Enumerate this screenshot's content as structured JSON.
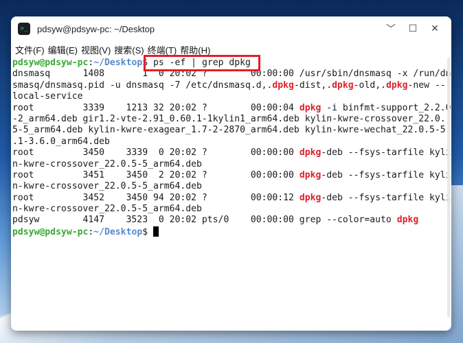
{
  "window": {
    "title": "pdsyw@pdsyw-pc: ~/Desktop",
    "icon": "terminal-icon",
    "controls": {
      "minimize": "﹀",
      "maximize": "☐",
      "close": "✕"
    }
  },
  "menubar": {
    "items": [
      "文件(F)",
      "编辑(E)",
      "视图(V)",
      "搜索(S)",
      "终端(T)",
      "帮助(H)"
    ]
  },
  "prompt": {
    "user": "pdsyw@pdsyw-pc",
    "sep": ":",
    "path": "~/Desktop",
    "symbol": "$"
  },
  "command": " ps -ef | grep dpkg",
  "output": {
    "l1": "dnsmasq      1408       1  0 20:02 ?        00:00:00 /usr/sbin/dnsmasq -x /run/dn",
    "l2a": "smasq/dnsmasq.pid -u dnsmasq -7 /etc/dnsmasq.d,.",
    "l2b": "dpkg",
    "l2c": "-dist,.",
    "l2d": "dpkg",
    "l2e": "-old,.",
    "l2f": "dpkg",
    "l2g": "-new --",
    "l3": "local-service",
    "l4a": "root         3339    1213 32 20:02 ?        00:00:04 ",
    "l4b": "dpkg",
    "l4c": " -i binfmt-support_2.2.0",
    "l5": "-2_arm64.deb gir1.2-vte-2.91_0.60.1-1kylin1_arm64.deb kylin-kwre-crossover_22.0.",
    "l6": "5-5_arm64.deb kylin-kwre-exagear_1.7-2-2870_arm64.deb kylin-kwre-wechat_22.0.5-5",
    "l7": ".1-3.6.0_arm64.deb",
    "l8a": "root         3450    3339  0 20:02 ?        00:00:00 ",
    "l8b": "dpkg",
    "l8c": "-deb --fsys-tarfile kyli",
    "l9": "n-kwre-crossover_22.0.5-5_arm64.deb",
    "l10a": "root         3451    3450  2 20:02 ?        00:00:00 ",
    "l10b": "dpkg",
    "l10c": "-deb --fsys-tarfile kyli",
    "l11": "n-kwre-crossover_22.0.5-5_arm64.deb",
    "l12a": "root         3452    3450 94 20:02 ?        00:00:12 ",
    "l12b": "dpkg",
    "l12c": "-deb --fsys-tarfile kyli",
    "l13": "n-kwre-crossover_22.0.5-5_arm64.deb",
    "l14a": "pdsyw        4147    3523  0 20:02 pts/0    00:00:00 grep --color=auto ",
    "l14b": "dpkg"
  },
  "colors": {
    "prompt_user": "#3aa835",
    "prompt_path": "#5a8ad0",
    "match_highlight": "#e0202a",
    "annotation_box": "#e01f27"
  }
}
